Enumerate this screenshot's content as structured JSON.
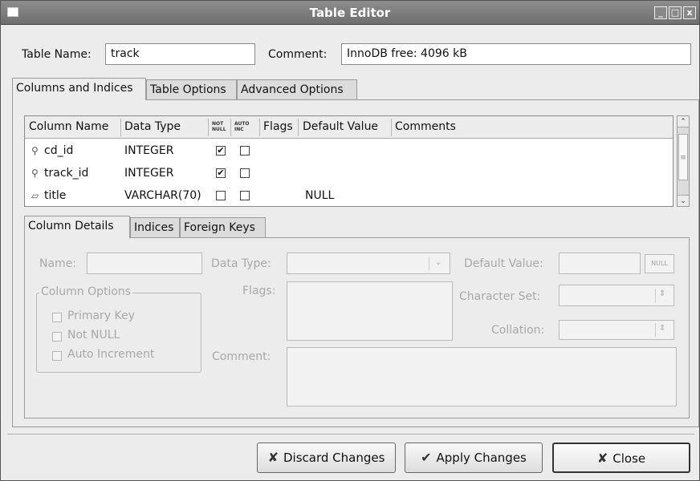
{
  "window": {
    "title": "Table Editor"
  },
  "header": {
    "table_name_label": "Table Name:",
    "table_name_value": "track",
    "comment_label": "Comment:",
    "comment_value": "InnoDB free: 4096 kB"
  },
  "main_tabs": [
    {
      "label": "Columns and Indices",
      "active": true
    },
    {
      "label": "Table Options",
      "active": false
    },
    {
      "label": "Advanced Options",
      "active": false
    }
  ],
  "columns_grid": {
    "headers": {
      "column_name": "Column Name",
      "data_type": "Data Type",
      "not_null": "NOT NULL",
      "auto_inc": "AUTO INC",
      "flags": "Flags",
      "default_value": "Default Value",
      "comments": "Comments"
    },
    "rows": [
      {
        "name": "cd_id",
        "type": "INTEGER",
        "not_null": true,
        "auto_inc": false,
        "flags": "",
        "default": "",
        "comment": "",
        "icon": "primary-key-icon"
      },
      {
        "name": "track_id",
        "type": "INTEGER",
        "not_null": true,
        "auto_inc": false,
        "flags": "",
        "default": "",
        "comment": "",
        "icon": "primary-key-icon"
      },
      {
        "name": "title",
        "type": "VARCHAR(70)",
        "not_null": false,
        "auto_inc": false,
        "flags": "",
        "default": "NULL",
        "comment": "",
        "icon": "column-icon"
      }
    ]
  },
  "sub_tabs": [
    {
      "label": "Column Details",
      "active": true
    },
    {
      "label": "Indices",
      "active": false
    },
    {
      "label": "Foreign Keys",
      "active": false
    }
  ],
  "details": {
    "name_label": "Name:",
    "data_type_label": "Data Type:",
    "default_value_label": "Default Value:",
    "null_button": "NULL",
    "column_options_label": "Column Options",
    "primary_key": "Primary Key",
    "not_null": "Not NULL",
    "auto_increment": "Auto Increment",
    "flags_label": "Flags:",
    "character_set_label": "Character Set:",
    "collation_label": "Collation:",
    "comment_label": "Comment:"
  },
  "buttons": {
    "discard": "Discard Changes",
    "apply": "Apply Changes",
    "close": "Close"
  }
}
